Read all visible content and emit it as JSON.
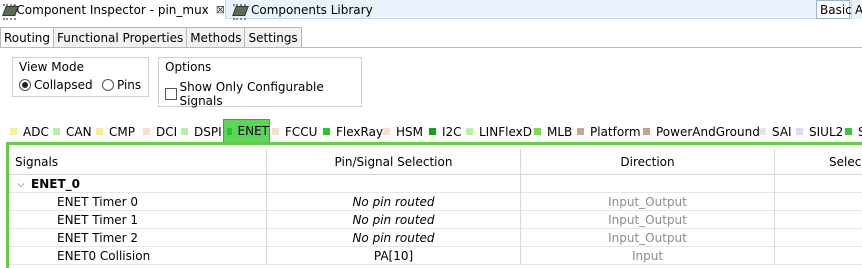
{
  "editor_tabs": {
    "active_label": "*Component Inspector - pin_mux",
    "library_label": "Components Library",
    "close_glyph": "⊠"
  },
  "perspectives": {
    "basic": "Basic",
    "advanced": "A"
  },
  "sub_tabs": [
    {
      "label": "Routing",
      "active": true
    },
    {
      "label": "Functional Properties",
      "active": false
    },
    {
      "label": "Methods",
      "active": false
    },
    {
      "label": "Settings",
      "active": false
    }
  ],
  "view_mode": {
    "title": "View Mode",
    "options": [
      {
        "label": "Collapsed",
        "selected": true
      },
      {
        "label": "Pins",
        "selected": false
      }
    ]
  },
  "options": {
    "title": "Options",
    "checkbox_label": "Show Only Configurable Signals",
    "checked": false
  },
  "modules": [
    {
      "label": "ADC",
      "color": "#f3ef9a"
    },
    {
      "label": "CAN",
      "color": "#b7f0a2"
    },
    {
      "label": "CMP",
      "color": "#f3ef9a"
    },
    {
      "label": "DCI",
      "color": "#f6dfcf"
    },
    {
      "label": "DSPI",
      "color": "#b7f0a2"
    },
    {
      "label": "ENET",
      "color": "#5bd65b",
      "active": true
    },
    {
      "label": "FCCU",
      "color": "#f6dfcf"
    },
    {
      "label": "FlexRay",
      "color": "#2cc42c"
    },
    {
      "label": "HSM",
      "color": "#f6dfcf"
    },
    {
      "label": "I2C",
      "color": "#1a9e1a"
    },
    {
      "label": "LINFlexD",
      "color": "#b7f0a2"
    },
    {
      "label": "MLB",
      "color": "#7bd75b"
    },
    {
      "label": "Platform",
      "color": "#c9a58b"
    },
    {
      "label": "PowerAndGround",
      "color": "#c3a48c"
    },
    {
      "label": "SAI",
      "color": "#efdff2"
    },
    {
      "label": "SIUL2",
      "color": "#e4d7f2"
    },
    {
      "label": "S",
      "color": "#3ec43e"
    }
  ],
  "table": {
    "headers": [
      "Signals",
      "Pin/Signal Selection",
      "Direction",
      "Selec"
    ],
    "group": "ENET_0",
    "rows": [
      {
        "signal": "ENET Timer 0",
        "pin": "No pin routed",
        "direction": "Input_Output",
        "routed": false
      },
      {
        "signal": "ENET Timer 1",
        "pin": "No pin routed",
        "direction": "Input_Output",
        "routed": false
      },
      {
        "signal": "ENET Timer 2",
        "pin": "No pin routed",
        "direction": "Input_Output",
        "routed": false
      },
      {
        "signal": "ENET0 Collision",
        "pin": "PA[10]",
        "direction": "Input",
        "routed": true
      }
    ]
  },
  "icons": {
    "tab_icon": "chip-icon",
    "expand": "chevron-down-icon"
  }
}
